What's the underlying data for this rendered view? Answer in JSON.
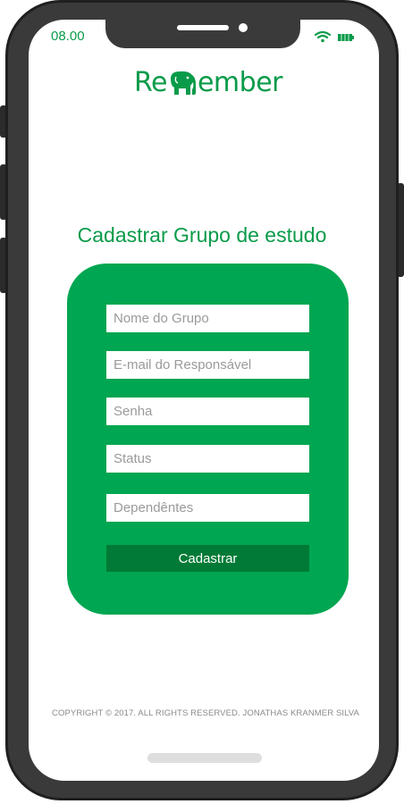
{
  "status_bar": {
    "time": "08.00",
    "wifi_icon": "wifi-icon",
    "battery_icon": "battery-icon"
  },
  "logo": {
    "prefix": "Re",
    "icon": "elephant-icon",
    "suffix": "ember"
  },
  "page": {
    "title": "Cadastrar Grupo de estudo"
  },
  "form": {
    "fields": [
      {
        "placeholder": "Nome do Grupo",
        "value": ""
      },
      {
        "placeholder": "E-mail do Responsável",
        "value": ""
      },
      {
        "placeholder": "Senha",
        "value": ""
      },
      {
        "placeholder": "Status",
        "value": ""
      },
      {
        "placeholder": "Dependêntes",
        "value": ""
      }
    ],
    "submit_label": "Cadastrar"
  },
  "footer": {
    "copyright": "COPYRIGHT © 2017. ALL RIGHTS RESERVED. JONATHAS KRANMER SILVA"
  },
  "colors": {
    "brand_green": "#0a9b4a",
    "card_green": "#00a651",
    "button_green": "#007a36",
    "phone_frame": "#3a3a3a"
  }
}
